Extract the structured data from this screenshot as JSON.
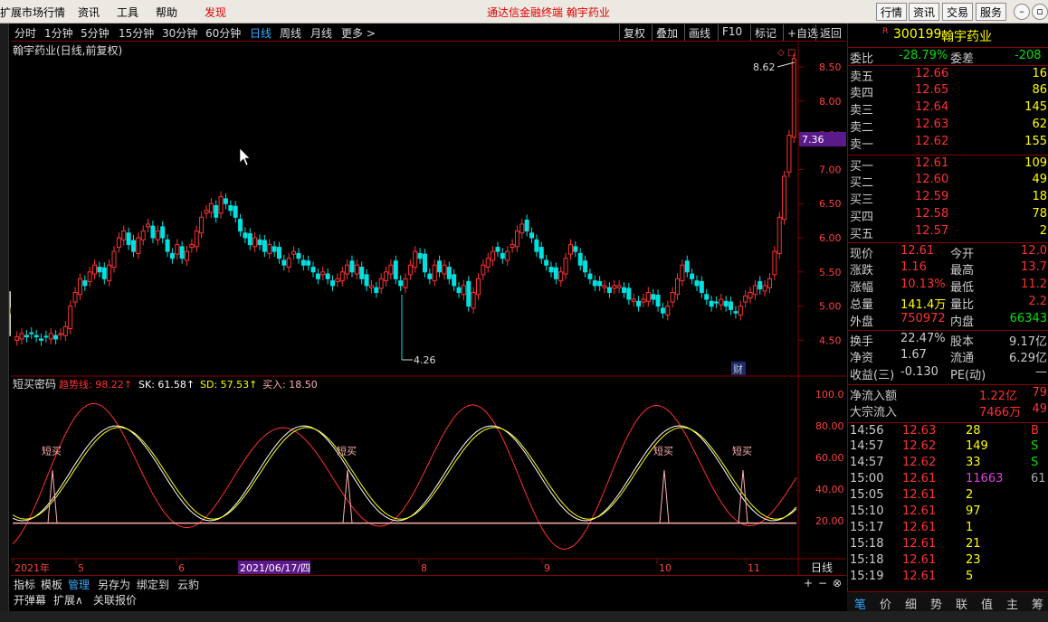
{
  "menu": {
    "items": [
      "扩展市场行情",
      "资讯",
      "工具",
      "帮助",
      "发现"
    ],
    "title": "通达信金融终端   翰宇药业",
    "right_buttons": [
      "行情",
      "资讯",
      "交易",
      "服务"
    ]
  },
  "toolbar": {
    "periods": [
      "分时",
      "1分钟",
      "5分钟",
      "15分钟",
      "30分钟",
      "60分钟",
      "日线",
      "周线",
      "月线",
      "更多 >"
    ],
    "active": "日线",
    "tools": [
      "复权",
      "叠加",
      "画线",
      "F10",
      "标记",
      "+自选",
      "返回"
    ]
  },
  "main_chart": {
    "title": "翰宇药业(日线,前复权)",
    "price_axis": [
      "8.50",
      "8.00",
      "7.50",
      "7.00",
      "6.50",
      "6.00",
      "5.50",
      "5.00",
      "4.50"
    ],
    "current_price_tag": "7.36",
    "high_label": "8.62",
    "low_label": "4.26",
    "cai_badge": "财",
    "colors": {
      "up": "#ff3232",
      "down": "#00e0e0",
      "tag_bg": "#5a1a8a"
    }
  },
  "indicator": {
    "name": "短买密码",
    "items": [
      {
        "label": "趋势线: 98.22↑",
        "color": "#ff3030"
      },
      {
        "label": "SK: 61.58↑",
        "color": "#ffffff"
      },
      {
        "label": "SD: 57.53↑",
        "color": "#ffff00"
      },
      {
        "label": "买入: 18.50",
        "color": "#ffb0b0"
      }
    ],
    "axis": [
      "100.0",
      "80.00",
      "60.00",
      "40.00",
      "20.00"
    ],
    "signal_label": "短买"
  },
  "date_axis": {
    "labels": [
      "2021年",
      "5",
      "6",
      "8",
      "9",
      "10",
      "11"
    ],
    "cursor_date": "2021/06/17/四",
    "period": "日线"
  },
  "bottom_tabs1": [
    "指标",
    "模板",
    "管理",
    "另存为",
    "绑定到",
    "云豹"
  ],
  "bottom_tabs1_active": "管理",
  "bottom_tabs2": [
    "开弹幕",
    "扩展∧",
    "关联报价"
  ],
  "quote": {
    "code": "300199",
    "name": "翰宇药业",
    "weibi": {
      "label": "委比",
      "value": "-28.79%",
      "label2": "委差",
      "value2": "-208"
    },
    "asks": [
      {
        "label": "卖五",
        "price": "12.66",
        "vol": "16"
      },
      {
        "label": "卖四",
        "price": "12.65",
        "vol": "86"
      },
      {
        "label": "卖三",
        "price": "12.64",
        "vol": "145"
      },
      {
        "label": "卖二",
        "price": "12.63",
        "vol": "62"
      },
      {
        "label": "卖一",
        "price": "12.62",
        "vol": "155"
      }
    ],
    "bids": [
      {
        "label": "买一",
        "price": "12.61",
        "vol": "109"
      },
      {
        "label": "买二",
        "price": "12.60",
        "vol": "49"
      },
      {
        "label": "买三",
        "price": "12.59",
        "vol": "18"
      },
      {
        "label": "买四",
        "price": "12.58",
        "vol": "78"
      },
      {
        "label": "买五",
        "price": "12.57",
        "vol": "2"
      }
    ],
    "stats": [
      {
        "l1": "现价",
        "v1": "12.61",
        "c1": "#ff3030",
        "l2": "今开",
        "v2": "12.0",
        "c2": "#ff3030"
      },
      {
        "l1": "涨跌",
        "v1": "1.16",
        "c1": "#ff3030",
        "l2": "最高",
        "v2": "13.7",
        "c2": "#ff3030"
      },
      {
        "l1": "涨幅",
        "v1": "10.13%",
        "c1": "#ff3030",
        "l2": "最低",
        "v2": "11.2",
        "c2": "#ff3030"
      },
      {
        "l1": "总量",
        "v1": "141.4万",
        "c1": "#ffff00",
        "l2": "量比",
        "v2": "2.2",
        "c2": "#ff3030"
      },
      {
        "l1": "外盘",
        "v1": "750972",
        "c1": "#ff3030",
        "l2": "内盘",
        "v2": "66343",
        "c2": "#00e000"
      }
    ],
    "stats2": [
      {
        "l1": "换手",
        "v1": "22.47%",
        "l2": "股本",
        "v2": "9.17亿"
      },
      {
        "l1": "净资",
        "v1": "1.67",
        "l2": "流通",
        "v2": "6.29亿"
      },
      {
        "l1": "收益(三)",
        "v1": "-0.130",
        "l2": "PE(动)",
        "v2": "—"
      }
    ],
    "flow": [
      {
        "label": "净流入额",
        "value": "1.22亿",
        "extra": "79"
      },
      {
        "label": "大宗流入",
        "value": "7466万",
        "extra": "49"
      }
    ],
    "ticks": [
      {
        "time": "14:56",
        "price": "12.63",
        "vol": "28",
        "bs": "B",
        "vc": "#ffff00",
        "bc": "#ff3030"
      },
      {
        "time": "14:57",
        "price": "12.62",
        "vol": "149",
        "bs": "S",
        "vc": "#ffff00",
        "bc": "#00e000"
      },
      {
        "time": "14:57",
        "price": "12.62",
        "vol": "33",
        "bs": "S",
        "vc": "#ffff00",
        "bc": "#00e000"
      },
      {
        "time": "15:00",
        "price": "12.61",
        "vol": "11663",
        "bs": "61",
        "vc": "#e040e0",
        "bc": "#aaaaaa"
      },
      {
        "time": "15:05",
        "price": "12.61",
        "vol": "2",
        "bs": "",
        "vc": "#ffff00",
        "bc": "#aaaaaa"
      },
      {
        "time": "15:10",
        "price": "12.61",
        "vol": "97",
        "bs": "",
        "vc": "#ffff00",
        "bc": "#aaaaaa"
      },
      {
        "time": "15:17",
        "price": "12.61",
        "vol": "1",
        "bs": "",
        "vc": "#ffff00",
        "bc": "#aaaaaa"
      },
      {
        "time": "15:18",
        "price": "12.61",
        "vol": "21",
        "bs": "",
        "vc": "#ffff00",
        "bc": "#aaaaaa"
      },
      {
        "time": "15:18",
        "price": "12.61",
        "vol": "23",
        "bs": "",
        "vc": "#ffff00",
        "bc": "#aaaaaa"
      },
      {
        "time": "15:19",
        "price": "12.61",
        "vol": "5",
        "bs": "",
        "vc": "#ffff00",
        "bc": "#aaaaaa"
      }
    ],
    "bottom_tabs": [
      "笔",
      "价",
      "细",
      "势",
      "联",
      "值",
      "主",
      "筹"
    ]
  }
}
